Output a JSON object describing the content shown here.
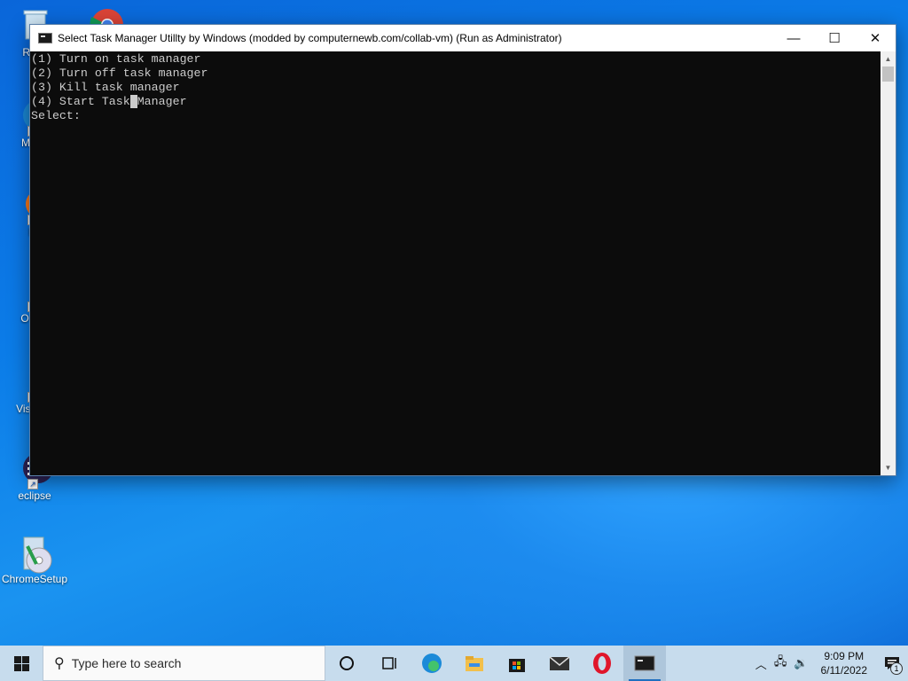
{
  "desktop": {
    "icons": [
      {
        "label": "Recy",
        "icon": "recycle-bin-icon"
      },
      {
        "label": "Mic E",
        "icon": "edge-icon"
      },
      {
        "label": "Fir",
        "icon": "firefox-icon"
      },
      {
        "label": "O Bro",
        "icon": "opera-icon"
      },
      {
        "label": "Visua C",
        "icon": "vscode-icon"
      },
      {
        "label": "eclipse",
        "icon": "eclipse-icon"
      },
      {
        "label": "ChromeSetup",
        "icon": "installer-icon"
      }
    ]
  },
  "window": {
    "title": "Select Task Manager Utillty by Windows (modded by computernewb.com/collab-vm) (Run as Administrator)",
    "minimize_glyph": "—",
    "maximize_glyph": "☐",
    "close_glyph": "✕",
    "console": {
      "lines": [
        "(1) Turn on task manager",
        "(2) Turn off task manager",
        "(3) Kill task manager"
      ],
      "line4_before_cursor": "(4) Start Task",
      "line4_cursor": " ",
      "line4_after_cursor": "Manager",
      "prompt": "Select:"
    }
  },
  "taskbar": {
    "search_placeholder": "Type here to search",
    "apps": [
      "task-view-icon",
      "widgets-icon",
      "edge-icon",
      "file-explorer-icon",
      "store-icon",
      "mail-icon",
      "opera-icon",
      "cmd-icon"
    ],
    "clock": {
      "time": "9:09 PM",
      "date": "6/11/2022"
    },
    "notification_count": "1"
  }
}
